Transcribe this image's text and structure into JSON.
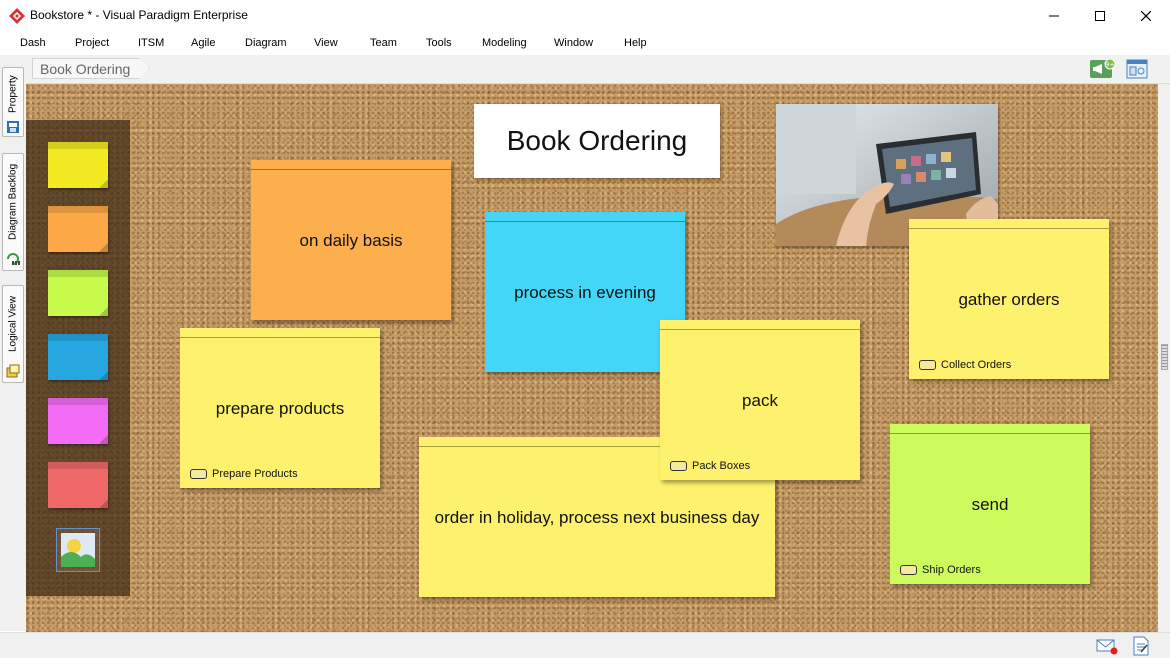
{
  "window": {
    "title": "Bookstore * - Visual Paradigm Enterprise",
    "app_icon": "visual-paradigm-logo",
    "controls": [
      "minimize-icon",
      "maximize-icon",
      "close-icon"
    ]
  },
  "menu": {
    "items": [
      "Dash",
      "Project",
      "ITSM",
      "Agile",
      "Diagram",
      "View",
      "Team",
      "Tools",
      "Modeling",
      "Window",
      "Help"
    ]
  },
  "side_tabs": [
    {
      "label": "Property",
      "icon": "property-icon"
    },
    {
      "label": "Diagram Backlog",
      "icon": "backlog-icon"
    },
    {
      "label": "Logical View",
      "icon": "logical-view-icon"
    }
  ],
  "breadcrumb": {
    "label": "Book Ordering"
  },
  "toolbar_right": {
    "notification_badge": "9+",
    "icons": [
      "announcement-icon",
      "diagram-navigator-icon"
    ]
  },
  "palette": {
    "notes": [
      {
        "color": "yellow",
        "hex": "#f4ea24"
      },
      {
        "color": "orange",
        "hex": "#fda846"
      },
      {
        "color": "lime",
        "hex": "#c8fa4c"
      },
      {
        "color": "blue",
        "hex": "#26a7e2"
      },
      {
        "color": "magenta",
        "hex": "#f46cf5"
      },
      {
        "color": "red",
        "hex": "#f06969"
      }
    ],
    "image_tool": "image-icon"
  },
  "board": {
    "title": "Book Ordering",
    "notes": [
      {
        "text": "on daily basis",
        "color": "orange"
      },
      {
        "text": "process in evening",
        "color": "cyan"
      },
      {
        "text": "prepare products",
        "color": "yellow",
        "ref": "Prepare Products"
      },
      {
        "text": "order in holiday, process next business day",
        "color": "yellow"
      },
      {
        "text": "pack",
        "color": "yellow",
        "ref": "Pack Boxes"
      },
      {
        "text": "gather orders",
        "color": "yellow",
        "ref": "Collect Orders"
      },
      {
        "text": "send",
        "color": "green",
        "ref": "Ship Orders"
      }
    ],
    "photo": "tablet-hands-photo"
  },
  "statusbar": {
    "icons": [
      "mail-icon",
      "document-icon"
    ]
  },
  "colors": {
    "cork": "#c49a64",
    "note_yellow": "#fef16e",
    "note_orange": "#fdae4d",
    "note_cyan": "#44d6f9",
    "note_green": "#cdfb5d"
  }
}
